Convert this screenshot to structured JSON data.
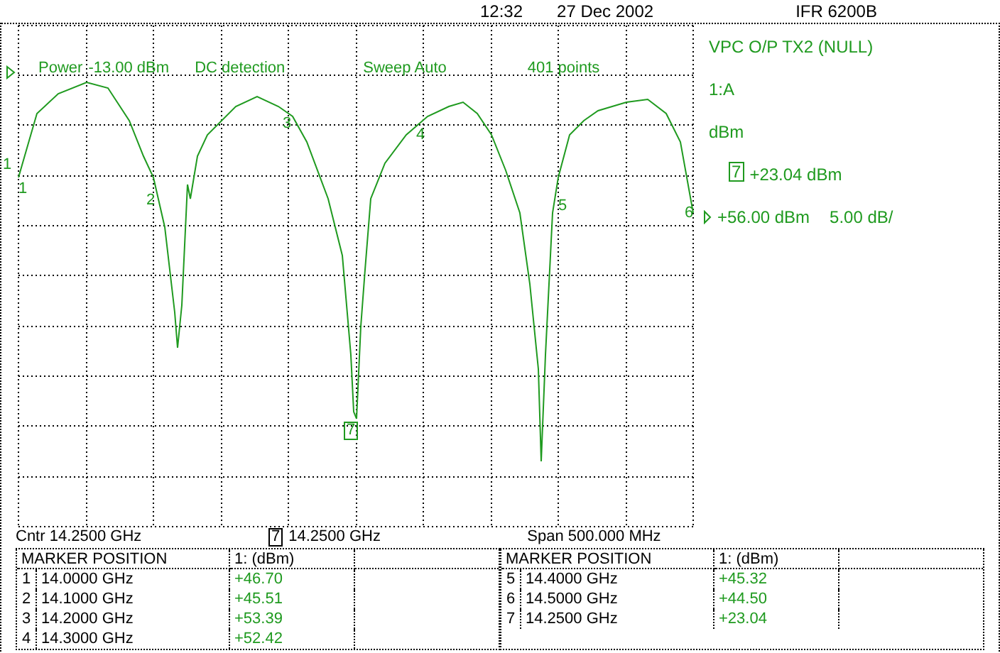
{
  "header": {
    "time": "12:32",
    "date": "27 Dec 2002",
    "instrument": "IFR 6200B"
  },
  "plot": {
    "info": [
      "Power",
      "-13.00 dBm",
      "DC detection",
      "Sweep Auto",
      "401 points"
    ],
    "reference_marker": "1",
    "markers": [
      {
        "label": "1",
        "boxed": false
      },
      {
        "label": "2",
        "boxed": false
      },
      {
        "label": "3",
        "boxed": false
      },
      {
        "label": "4",
        "boxed": false
      },
      {
        "label": "5",
        "boxed": false
      },
      {
        "label": "6",
        "boxed": false
      },
      {
        "label": "7",
        "boxed": true
      }
    ]
  },
  "side_panel": {
    "title": "VPC O/P TX2 (NULL)",
    "trace": "1:A",
    "units": "dBm",
    "active_marker": {
      "label": "7",
      "reading": "+23.04 dBm"
    },
    "reference": {
      "level": "+56.00 dBm",
      "scale": "5.00 dB/"
    }
  },
  "footer": {
    "center": "Cntr 14.2500 GHz",
    "marker": {
      "label": "7",
      "frequency": "14.2500 GHz"
    },
    "span": "Span 500.000 MHz"
  },
  "marker_tables": [
    {
      "columns": [
        "MARKER POSITION",
        "1: (dBm)"
      ],
      "rows": [
        {
          "index": "1",
          "position": "14.0000 GHz",
          "value": "+46.70"
        },
        {
          "index": "2",
          "position": "14.1000 GHz",
          "value": "+45.51"
        },
        {
          "index": "3",
          "position": "14.2000 GHz",
          "value": "+53.39"
        },
        {
          "index": "4",
          "position": "14.3000 GHz",
          "value": "+52.42"
        }
      ]
    },
    {
      "columns": [
        "MARKER POSITION",
        "1: (dBm)"
      ],
      "rows": [
        {
          "index": "5",
          "position": "14.4000 GHz",
          "value": "+45.32"
        },
        {
          "index": "6",
          "position": "14.5000 GHz",
          "value": "+44.50"
        },
        {
          "index": "7",
          "position": "14.2500 GHz",
          "value": "+23.04"
        }
      ]
    }
  ]
}
